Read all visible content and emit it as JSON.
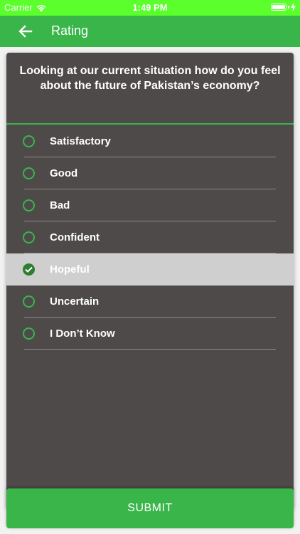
{
  "status_bar": {
    "carrier": "Carrier",
    "time": "1:49 PM",
    "icons": [
      "wifi-icon",
      "battery-icon",
      "charging-bolt-icon"
    ]
  },
  "app_bar": {
    "title": "Rating",
    "back_icon": "arrow-left-icon"
  },
  "question": "Looking at our current situation how do you feel about the future of Pakistan’s economy?",
  "options": [
    {
      "label": "Satisfactory",
      "selected": false
    },
    {
      "label": "Good",
      "selected": false
    },
    {
      "label": "Bad",
      "selected": false
    },
    {
      "label": "Confident",
      "selected": false
    },
    {
      "label": "Hopeful",
      "selected": true
    },
    {
      "label": "Uncertain",
      "selected": false
    },
    {
      "label": "I Don’t Know",
      "selected": false
    }
  ],
  "submit_label": "SUBMIT",
  "colors": {
    "status_bar": "#5bff2c",
    "primary_green": "#39b54a",
    "card_bg": "#4e4a4a",
    "selected_row_bg": "#cfcfcf",
    "checked_radio": "#2e7d32"
  }
}
